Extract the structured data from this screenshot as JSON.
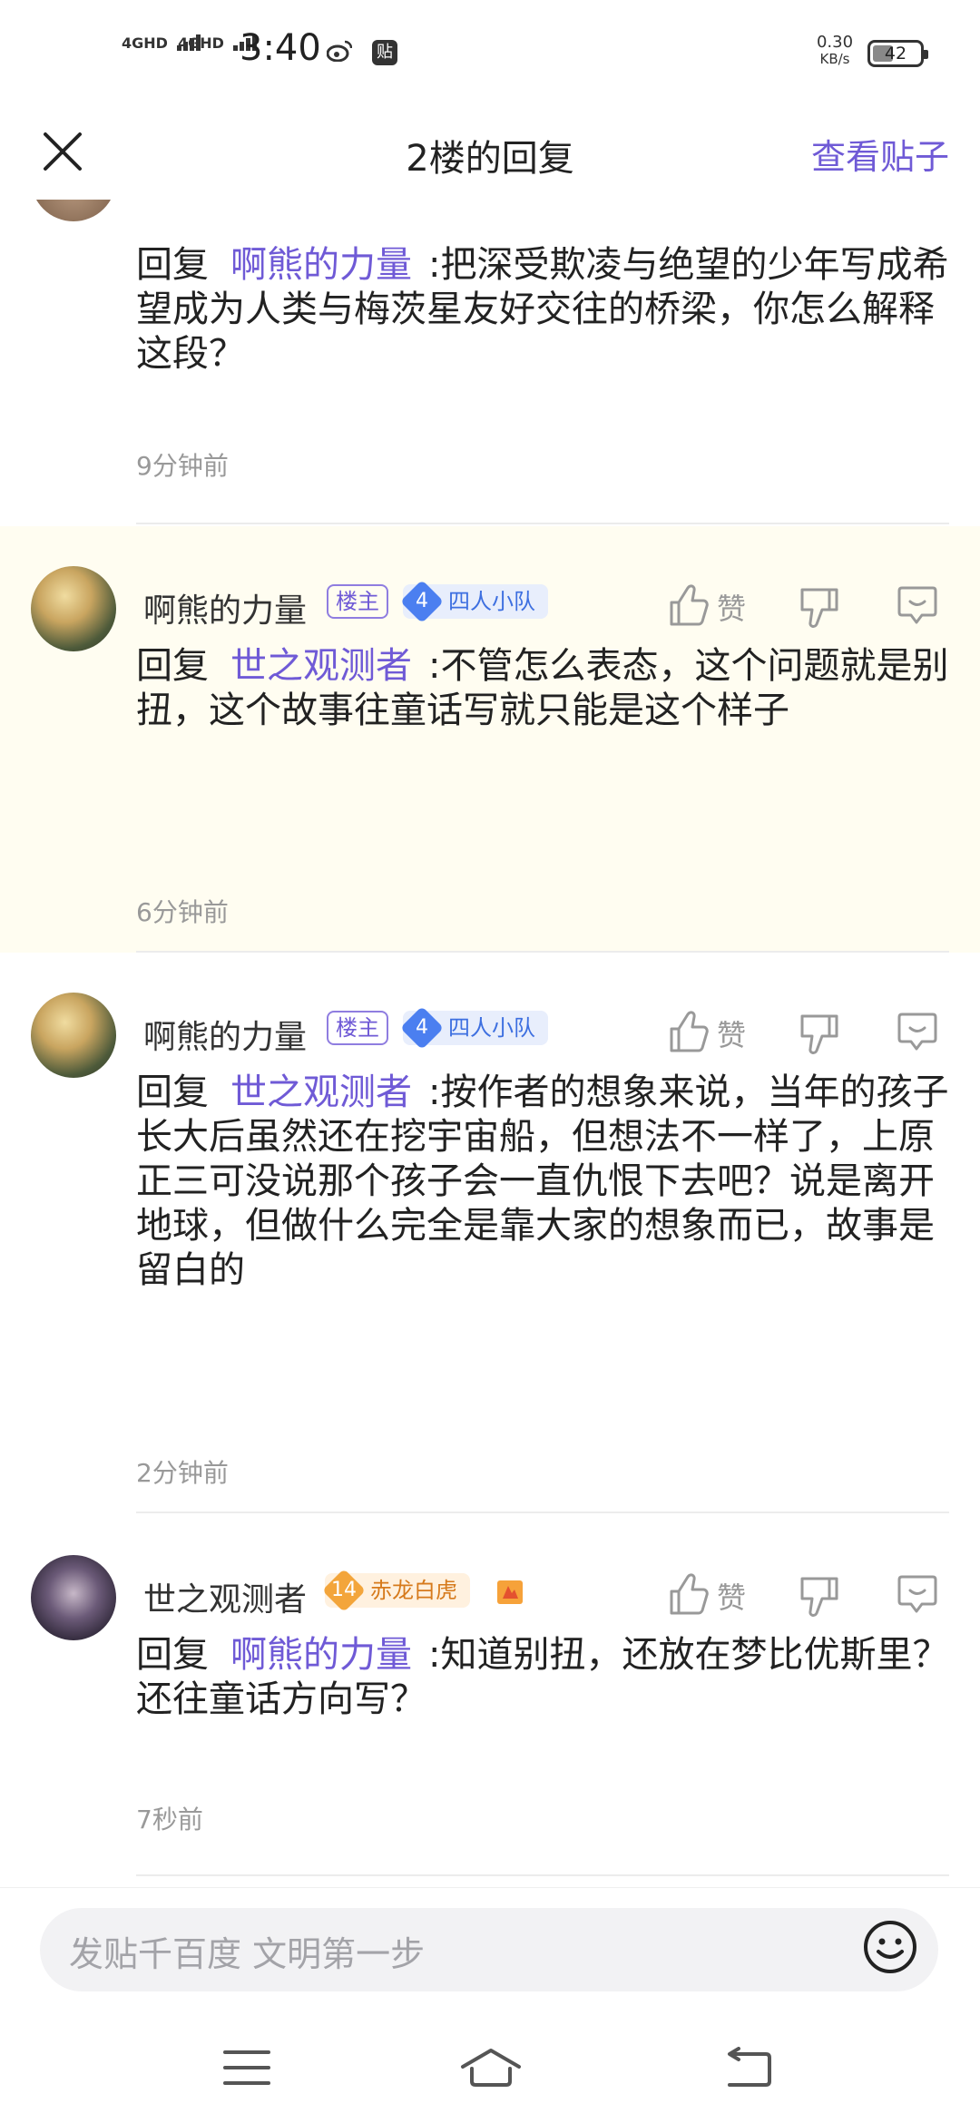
{
  "status_bar": {
    "sim1": "4GHD",
    "sim2": "4GHD",
    "time": "3:40",
    "notif_icon": "贴",
    "speed_value": "0.30",
    "speed_unit": "KB/s",
    "battery": "42"
  },
  "header": {
    "title": "2楼的回复",
    "view_post": "查看贴子"
  },
  "comments": [
    {
      "reply_prefix": "回复",
      "reply_target": "啊熊的力量",
      "text": ":把深受欺凌与绝望的少年写成希望成为人类与梅茨星友好交往的桥梁，你怎么解释这段？",
      "time": "9分钟前"
    },
    {
      "username": "啊熊的力量",
      "owner_badge": "楼主",
      "level": "4",
      "level_title": "四人小队",
      "like_label": "赞",
      "reply_prefix": "回复",
      "reply_target": "世之观测者",
      "text": ":不管怎么表态，这个问题就是别扭，这个故事往童话写就只能是这个样子",
      "time": "6分钟前"
    },
    {
      "username": "啊熊的力量",
      "owner_badge": "楼主",
      "level": "4",
      "level_title": "四人小队",
      "like_label": "赞",
      "reply_prefix": "回复",
      "reply_target": "世之观测者",
      "text": ":按作者的想象来说，当年的孩子长大后虽然还在挖宇宙船，但想法不一样了，上原正三可没说那个孩子会一直仇恨下去吧？说是离开地球，但做什么完全是靠大家的想象而已，故事是留白的",
      "time": "2分钟前"
    },
    {
      "username": "世之观测者",
      "level": "14",
      "level_title": "赤龙白虎",
      "like_label": "赞",
      "reply_prefix": "回复",
      "reply_target": "啊熊的力量",
      "text": ":知道别扭，还放在梦比优斯里？还往童话方向写？",
      "time": "7秒前"
    }
  ],
  "input": {
    "placeholder": "发贴千百度  文明第一步"
  },
  "colors": {
    "accent": "#6f5ad6",
    "highlight_bg": "#fffdf1",
    "level_blue": "#4b7ff0",
    "level_gold": "#f3a53b"
  }
}
